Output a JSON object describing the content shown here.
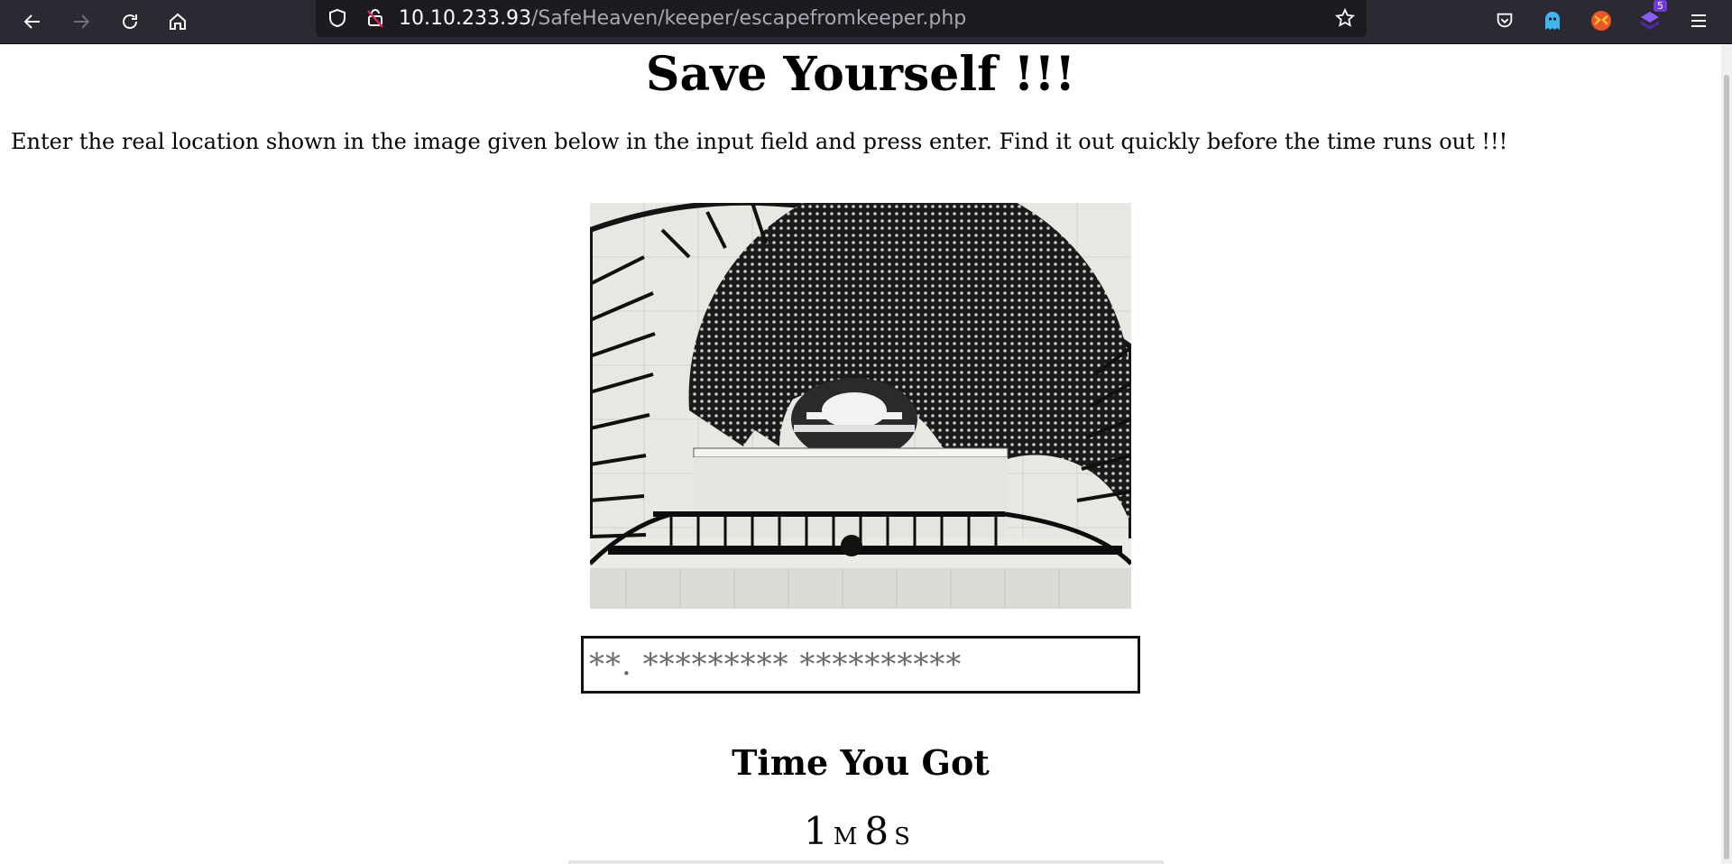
{
  "browser": {
    "url_host": "10.10.233.93",
    "url_path": "/SafeHeaven/keeper/escapefromkeeper.php",
    "extension_badge": "5",
    "icons": {
      "back": "back-arrow-icon",
      "forward": "forward-arrow-icon",
      "reload": "reload-icon",
      "home": "home-icon",
      "shield": "shield-icon",
      "insecure_lock": "insecure-lock-icon",
      "bookmark": "star-icon",
      "pocket": "pocket-icon",
      "ghost": "ghost-extension-icon",
      "foxy": "foxyproxy-extension-icon",
      "wappalyzer": "wappalyzer-extension-icon",
      "menu": "hamburger-menu-icon"
    }
  },
  "page": {
    "title": "Save Yourself !!!",
    "instructions": "Enter the real location shown in the image given below in the input field and press enter. Find it out quickly before the time runs out !!!",
    "image_subject": "spiral-staircase-photo",
    "input_placeholder": "**. ********* **********",
    "timer_heading": "Time You Got",
    "timer_minutes": "1",
    "timer_minutes_unit": "M",
    "timer_seconds": "8",
    "timer_seconds_unit": "S"
  }
}
